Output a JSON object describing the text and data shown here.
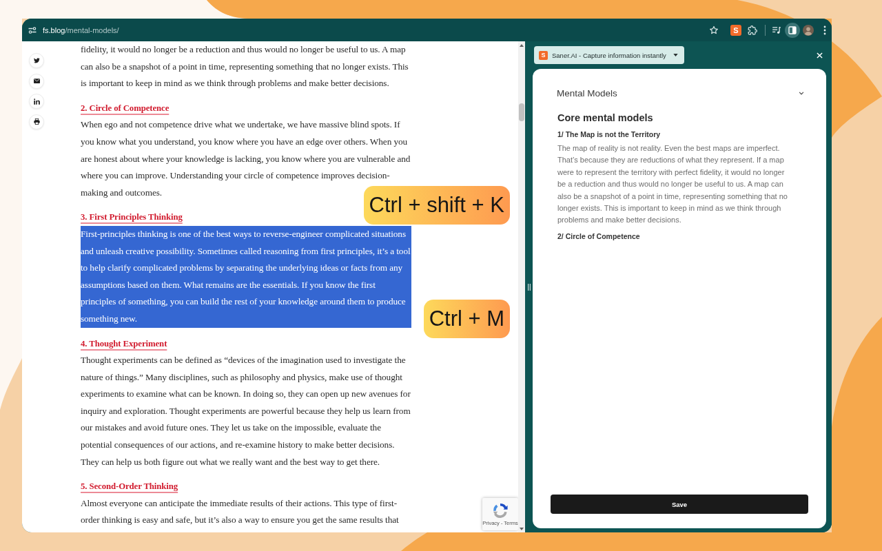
{
  "browser": {
    "address_host": "fs.blog",
    "address_path": "/mental-models/",
    "extension_badge": "S",
    "side_panel_open": true
  },
  "article": {
    "sections": [
      {
        "text": "fidelity, it would no longer be a reduction and thus would no longer be useful to us. A map can also be a snapshot of a point in time, representing something that no longer exists. This is important to keep in mind as we think through problems and make better decisions.",
        "selected": false
      },
      {
        "heading": "2. Circle of Competence",
        "text": "When ego and not competence drive what we undertake, we have massive blind spots. If you know what you understand, you know where you have an edge over others. When you are honest about where your knowledge is lacking, you know where you are vulnerable and where you can improve. Understanding your circle of competence improves decision-making and outcomes.",
        "selected": false
      },
      {
        "heading": "3. First Principles Thinking",
        "text": "First-principles thinking is one of the best ways to reverse-engineer complicated situations and unleash creative possibility. Sometimes called reasoning from first principles, it’s a tool to help clarify complicated problems by separating the underlying ideas or facts from any assumptions based on them. What remains are the essentials. If you know the first principles of something, you can build the rest of your knowledge around them to produce something new.",
        "selected": true
      },
      {
        "heading": "4. Thought Experiment",
        "text": "Thought experiments can be defined as “devices of the imagination used to investigate the nature of things.” Many disciplines, such as philosophy and physics, make use of thought experiments to examine what can be known. In doing so, they can open up new avenues for inquiry and exploration. Thought experiments are powerful because they help us learn from our mistakes and avoid future ones. They let us take on the impossible, evaluate the potential consequences of our actions, and re-examine history to make better decisions. They can help us both figure out what we really want and the best way to get there.",
        "selected": false
      },
      {
        "heading": "5. Second-Order Thinking",
        "text": "Almost everyone can anticipate the immediate results of their actions. This type of first-order thinking is easy and safe, but it’s also a way to ensure you get the same results that",
        "selected": false
      }
    ]
  },
  "shortcut_badges": [
    "Ctrl + shift + K",
    "Ctrl + M"
  ],
  "recaptcha": {
    "links": "Privacy - Terms"
  },
  "side_panel": {
    "app_selector": {
      "logo": "S",
      "title": "Saner.AI - Capture information instantly"
    },
    "card": {
      "collection": "Mental Models",
      "title": "Core mental models",
      "blocks": [
        {
          "kind": "subheading",
          "text": "1/ The Map is not the Territory"
        },
        {
          "kind": "paragraph",
          "text": "The map of reality is not reality. Even the best maps are imperfect. That’s because they are reductions of what they represent. If a map were to represent the territory with perfect fidelity, it would no longer be a reduction and thus would no longer be useful to us. A map can also be a snapshot of a point in time, representing something that no longer exists. This is important to keep in mind as we think through problems and make better decisions."
        },
        {
          "kind": "subheading",
          "text": "2/ Circle of Competence"
        }
      ],
      "save_label": "Save"
    }
  }
}
